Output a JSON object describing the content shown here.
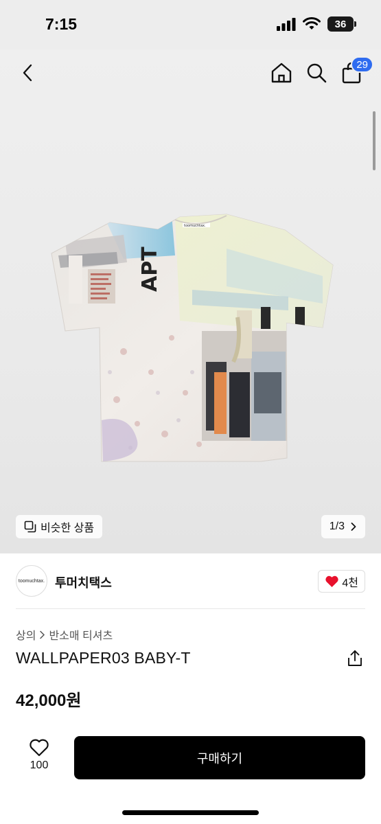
{
  "status": {
    "time": "7:15",
    "battery": "36"
  },
  "nav": {
    "cart_count": "29"
  },
  "hero": {
    "similar_label": "비슷한 상품",
    "pager_label": "1/3",
    "tag_text": "toomuchtax."
  },
  "seller": {
    "avatar_text": "toomuchtax.",
    "name": "투머치택스",
    "likes": "4천"
  },
  "product": {
    "breadcrumb": [
      "상의",
      "반소매 티셔츠"
    ],
    "title": "WALLPAPER03 BABY-T",
    "price": "42,000원"
  },
  "bottom": {
    "wish_count": "100",
    "buy_label": "구매하기"
  },
  "colors": {
    "accent": "#2f6cf0",
    "heart": "#e8112d",
    "buy": "#000000"
  }
}
